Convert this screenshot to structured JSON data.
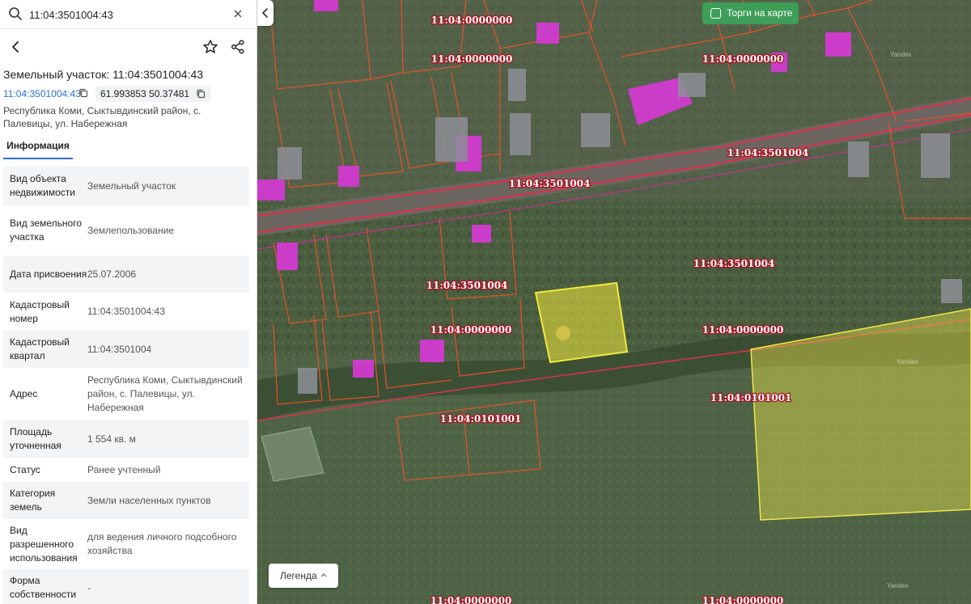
{
  "search": {
    "value": "11:04:3501004:43",
    "placeholder": ""
  },
  "card": {
    "title": "Земельный участок: 11:04:3501004:43",
    "cadastral_link": "11:04:3501004:43",
    "coords": "61.993853 50.37481",
    "address_line": "Республика Коми, Сыктывдинский район, с. Палевицы, ул. Набережная",
    "tab_label": "Информация",
    "properties": [
      {
        "label": "Вид объекта недвижимости",
        "value": "Земельный участок"
      },
      {
        "label": "Вид земельного участка",
        "value": "Землепользование"
      },
      {
        "label": "Дата присвоения",
        "value": "25.07.2006"
      },
      {
        "label": "Кадастровый номер",
        "value": "11:04:3501004:43"
      },
      {
        "label": "Кадастровый квартал",
        "value": "11:04:3501004"
      },
      {
        "label": "Адрес",
        "value": "Республика Коми, Сыктывдинский район, с. Палевицы, ул. Набережная"
      },
      {
        "label": "Площадь уточненная",
        "value": "1 554 кв. м"
      },
      {
        "label": "Статус",
        "value": "Ранее учтенный"
      },
      {
        "label": "Категория земель",
        "value": "Земли населенных пунктов"
      },
      {
        "label": "Вид разрешенного использования",
        "value": "для ведения личного подсобного хозяйства"
      },
      {
        "label": "Форма собственности",
        "value": "-"
      }
    ]
  },
  "map": {
    "auction_label": "Торги на карте",
    "legend_label": "Легенда",
    "watermark": "Yandex",
    "labels": [
      "11:04:0000000",
      "11:04:0000000",
      "11:04:0000000",
      "11:04:3501004",
      "11:04:3501004",
      "11:04:3501004",
      "11:04:3501004",
      "11:04:0000000",
      "11:04:0000000",
      "11:04:0101001",
      "11:04:0101001",
      "11:04:0000000",
      "11:04:0000000"
    ],
    "colors": {
      "boundary": "#e8502a",
      "road_line": "#e0304a",
      "building": "#d63ad4",
      "selected_parcel": "#f2ea3a",
      "highlight_parcel": "#e6e14a",
      "auction_toggle": "#3e9d58",
      "link": "#2b6fd6"
    },
    "icons": [
      "search-icon",
      "clear-icon",
      "back-icon",
      "star-icon",
      "share-icon",
      "copy-icon",
      "chevron-left-icon",
      "chevron-up-icon"
    ]
  }
}
